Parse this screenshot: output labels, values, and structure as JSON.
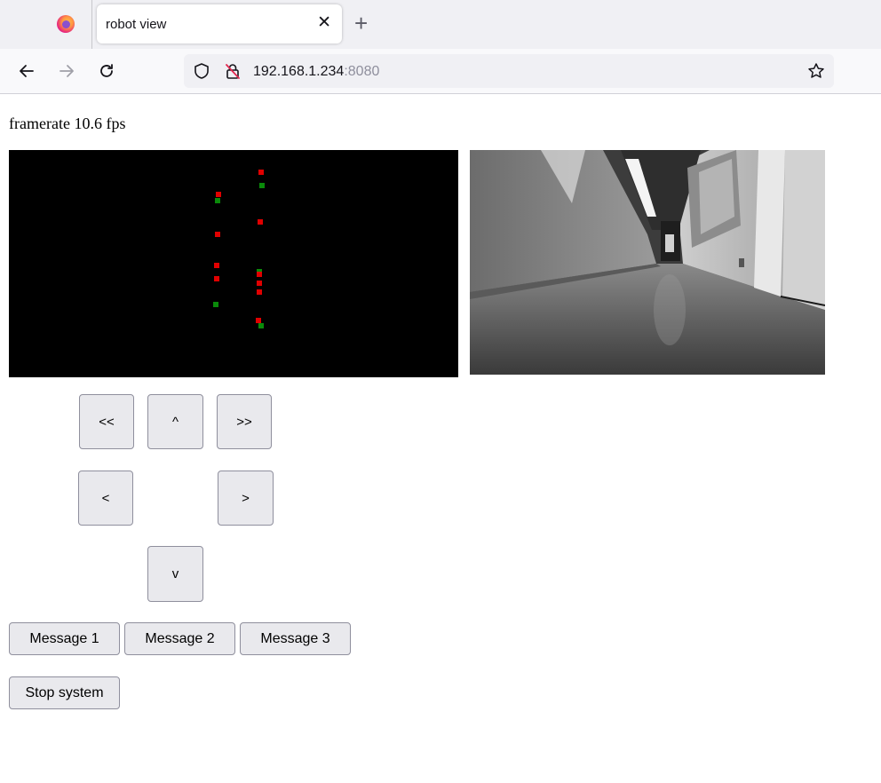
{
  "browser": {
    "tab_title": "robot view",
    "tab_close": "✕",
    "new_tab": "+",
    "url_host": "192.168.1.234",
    "url_port": ":8080"
  },
  "page": {
    "framerate_label": "framerate",
    "framerate_value": "10.6",
    "framerate_unit": "fps"
  },
  "depth_view": {
    "background": "#000000",
    "point_colors": {
      "red": "#e00000",
      "green": "#0a8a0a"
    }
  },
  "controls": {
    "rotate_left": "<<",
    "forward": "^",
    "rotate_right": ">>",
    "left": "<",
    "right": ">",
    "backward": "v"
  },
  "messages": {
    "message_1": "Message 1",
    "message_2": "Message 2",
    "message_3": "Message 3",
    "stop": "Stop system"
  }
}
